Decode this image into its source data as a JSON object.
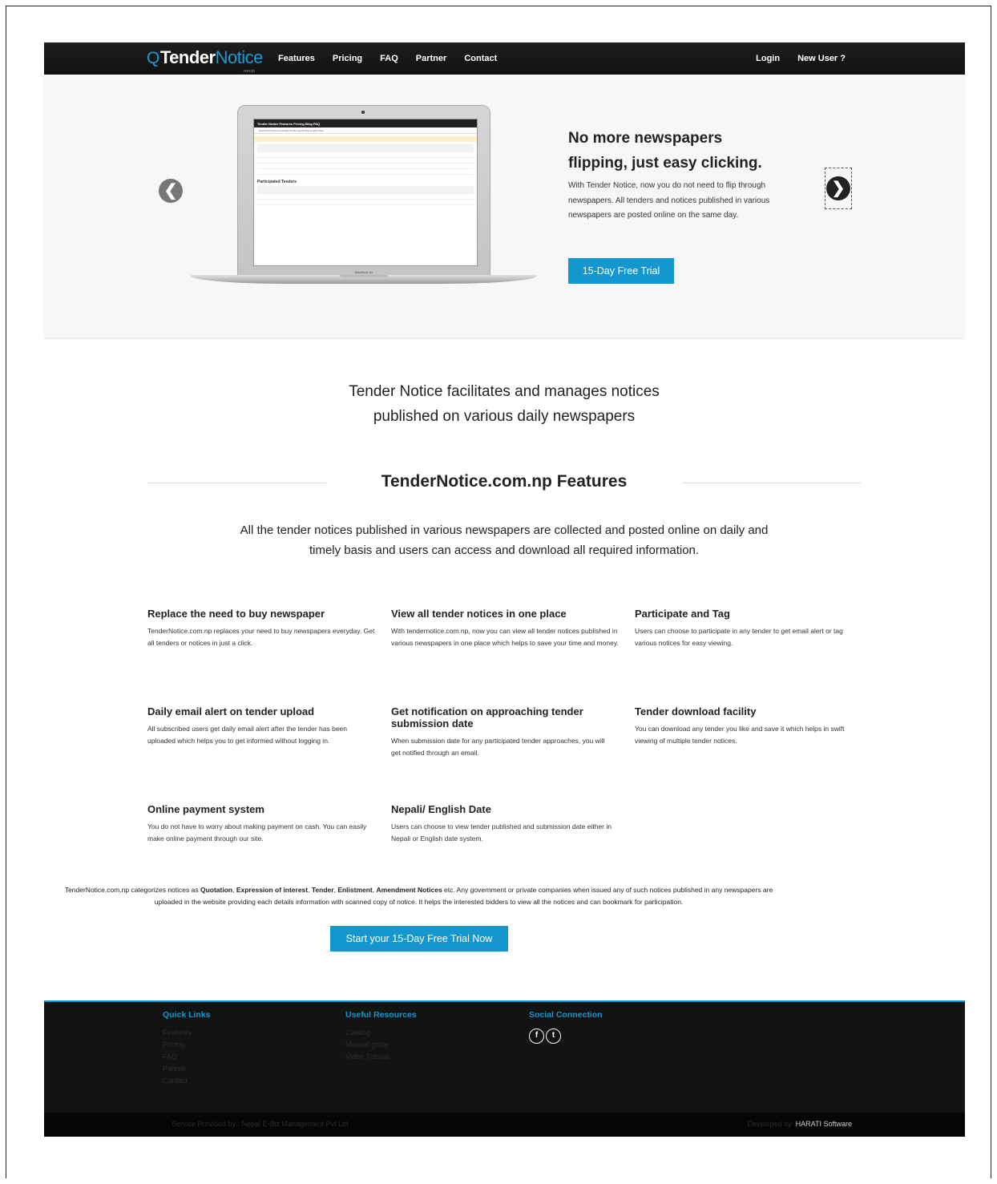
{
  "nav": {
    "logo_q": "Q",
    "logo_bold": "Tender",
    "logo_light": "Notice",
    "logo_tag": ".com.np",
    "links": [
      "Features",
      "Pricing",
      "FAQ",
      "Partner",
      "Contact"
    ],
    "login": "Login",
    "new_user": "New User ?"
  },
  "hero": {
    "title_line1": "No more newspapers",
    "title_line2": "flipping, just easy clicking.",
    "text": "With Tender Notice, now you do not need to flip through newspapers. All tenders and notices published in various newspapers are posted online on the same day.",
    "button": "15-Day Free Trial",
    "prev_arrow": "❮",
    "next_arrow": "❯",
    "laptop": {
      "app_bar": "Tender Notice   Features   Pricing   Blog   FAQ",
      "subnav": "Dashboard    Payment Details    Profile    Nepali Date    English Date",
      "section": "Participated Tenders",
      "model": "MacBook Air"
    }
  },
  "intro": {
    "line1": "Tender Notice facilitates and manages notices",
    "line2": "published on various daily newspapers"
  },
  "features": {
    "title": "TenderNotice.com.np Features",
    "desc_line1": "All the tender notices published in various newspapers are collected and posted online on daily and",
    "desc_line2": "timely basis and users can access and download all required information.",
    "items": [
      {
        "title": "Replace the need to buy newspaper",
        "text": "TenderNotice.com.np replaces your need to buy newspapers everyday. Get all tenders or notices in just a click."
      },
      {
        "title": "View all tender notices in one place",
        "text": "With tendernotice.com.np, now you can view all tender notices published in various newspapers in one place which helps to save your time and money."
      },
      {
        "title": "Participate and Tag",
        "text": "Users can choose to participate in any tender to get email alert or tag various notices for easy viewing."
      },
      {
        "title": "Daily email alert on tender upload",
        "text": "All subscribed users get daily email alert after the tender has been uploaded which helps you to get informed without logging in."
      },
      {
        "title": "Get notification on approaching tender submission date",
        "text": "When submission date for any participated tender approaches, you will get notified through an email."
      },
      {
        "title": "Tender download facility",
        "text": "You can download any tender you like and save it which helps in swift viewing of multiple tender notices."
      },
      {
        "title": "Online payment system",
        "text": "You do not have to worry about making payment on cash. You can easily make online payment through our site."
      },
      {
        "title": "Nepali/ English Date",
        "text": "Users can choose to view tender published and submission date either in Nepali or English date system."
      }
    ]
  },
  "categories": {
    "prefix": "TenderNotice.com.np categorizes notices as ",
    "c1": "Quotation",
    "sep1": ", ",
    "c2": "Expression of interest",
    "sep2": ", ",
    "c3": "Tender",
    "sep3": ", ",
    "c4": "Enlistment",
    "sep4": ", ",
    "c5": "Amendment Notices",
    "suffix": " etc. Any government or private companies when issued any of such notices published in any newspapers are uploaded in the website providing each details information with scanned copy of notice. It helps the interested bidders to view all the notices and can bookmark for participation.",
    "cta": "Start your 15-Day Free Trial Now"
  },
  "footer": {
    "quick_links_title": "Quick Links",
    "quick_links": [
      "Features",
      "Pricing",
      "FAQ",
      "Partner",
      "Contact"
    ],
    "resources_title": "Useful Resources",
    "resources": [
      "Catalog",
      "Manual guide",
      "Video Tutorial"
    ],
    "social_title": "Social Connection",
    "social": [
      "f",
      "t"
    ],
    "provided_by": "Service Provided by : Nepal E-Biz Management Pvt Ltd",
    "developed_prefix": "Developed by: ",
    "developed_name": "HARATI Software"
  }
}
